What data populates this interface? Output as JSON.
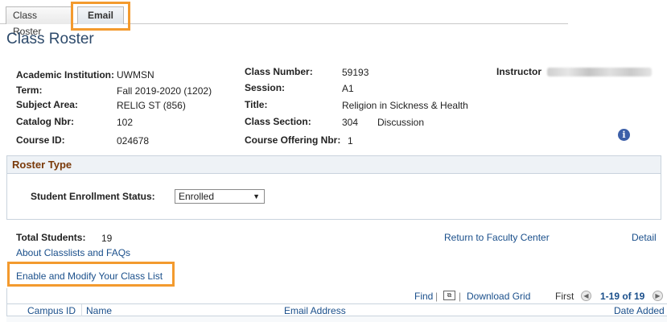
{
  "tabs": [
    {
      "label": "Class Roster",
      "active": false
    },
    {
      "label": "Email",
      "active": true
    }
  ],
  "page_title": "Class Roster",
  "class_info": {
    "academic_institution": {
      "label": "Academic Institution:",
      "value": "UWMSN"
    },
    "term": {
      "label": "Term:",
      "value": "Fall 2019-2020 (1202)"
    },
    "subject_area": {
      "label": "Subject Area:",
      "value": "RELIG ST (856)"
    },
    "catalog_nbr": {
      "label": "Catalog Nbr:",
      "value": "102"
    },
    "course_id": {
      "label": "Course ID:",
      "value": "024678"
    },
    "class_number": {
      "label": "Class Number:",
      "value": "59193"
    },
    "session": {
      "label": "Session:",
      "value": "A1"
    },
    "title": {
      "label": "Title:",
      "value": "Religion in Sickness & Health"
    },
    "class_section": {
      "label": "Class Section:",
      "value": "304",
      "component": "Discussion"
    },
    "course_offering_nbr": {
      "label": "Course Offering Nbr:",
      "value": "1"
    },
    "instructor": {
      "label": "Instructor"
    }
  },
  "icons": {
    "info": "info-circle-icon",
    "grid": "download-grid-icon",
    "prev": "previous-arrow-icon",
    "next": "next-arrow-icon"
  },
  "roster_type": {
    "heading": "Roster Type",
    "status_label": "Student Enrollment Status:",
    "status_value": "Enrolled"
  },
  "totals": {
    "label": "Total Students:",
    "value": "19"
  },
  "links": {
    "faculty_center": "Return to Faculty Center",
    "detail": "Detail",
    "faqs": "About Classlists and FAQs",
    "enable_modify": "Enable and Modify Your Class List"
  },
  "grid": {
    "find": "Find",
    "download": "Download Grid",
    "first": "First",
    "range": "1-19 of 19",
    "columns": [
      "Campus ID",
      "Name",
      "Email Address",
      "Date Added"
    ]
  },
  "colors": {
    "highlight": "#f39a2e",
    "link": "#1a4f8b",
    "title": "#2d4a6b",
    "section_heading": "#7a3a0a"
  }
}
